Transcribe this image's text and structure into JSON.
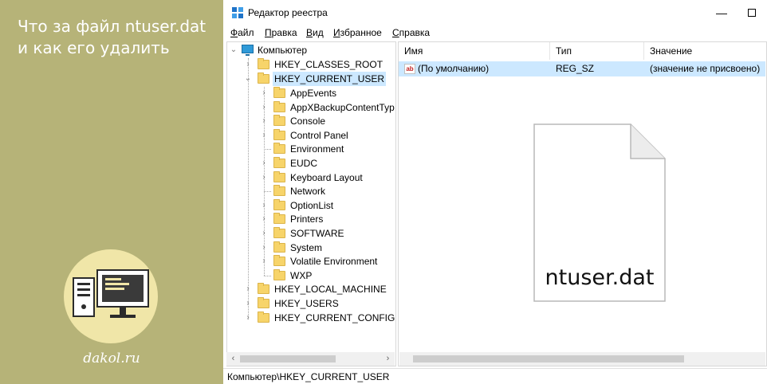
{
  "banner": {
    "title": "Что за файл ntuser.dat и как его удалить",
    "site": "dakol.ru",
    "logo_icon": "computer-monitor-icon",
    "colors": {
      "background": "#b6b378",
      "circle": "#f0e6a8"
    }
  },
  "window": {
    "title": "Редактор реестра",
    "icons": {
      "app": "registry-editor-icon",
      "minimize": "minimize-icon",
      "maximize": "maximize-icon"
    },
    "menu": [
      {
        "label": "Файл",
        "key": "Ф",
        "rest": "айл"
      },
      {
        "label": "Правка",
        "key": "П",
        "rest": "равка"
      },
      {
        "label": "Вид",
        "key": "В",
        "rest": "ид"
      },
      {
        "label": "Избранное",
        "key": "И",
        "rest": "збранное"
      },
      {
        "label": "Справка",
        "key": "С",
        "rest": "правка"
      }
    ]
  },
  "tree": {
    "root": "Компьютер",
    "hives_top": [
      "HKEY_CLASSES_ROOT"
    ],
    "current": "HKEY_CURRENT_USER",
    "children": [
      {
        "label": "AppEvents",
        "expandable": true
      },
      {
        "label": "AppXBackupContentTyp",
        "expandable": true
      },
      {
        "label": "Console",
        "expandable": true
      },
      {
        "label": "Control Panel",
        "expandable": true
      },
      {
        "label": "Environment",
        "expandable": false
      },
      {
        "label": "EUDC",
        "expandable": true
      },
      {
        "label": "Keyboard Layout",
        "expandable": true
      },
      {
        "label": "Network",
        "expandable": false
      },
      {
        "label": "OptionList",
        "expandable": true
      },
      {
        "label": "Printers",
        "expandable": true
      },
      {
        "label": "SOFTWARE",
        "expandable": true
      },
      {
        "label": "System",
        "expandable": true
      },
      {
        "label": "Volatile Environment",
        "expandable": true
      },
      {
        "label": "WXP",
        "expandable": false
      }
    ],
    "hives_bottom": [
      "HKEY_LOCAL_MACHINE",
      "HKEY_USERS",
      "HKEY_CURRENT_CONFIG"
    ]
  },
  "list": {
    "columns": [
      "Имя",
      "Тип",
      "Значение"
    ],
    "rows": [
      {
        "name": "(По умолчанию)",
        "type": "REG_SZ",
        "value": "(значение не присвоено)",
        "icon": "string-value-icon",
        "icon_text": "ab"
      }
    ]
  },
  "overlay": {
    "file_label": "ntuser.dat",
    "icon": "file-document-icon"
  },
  "status": {
    "path": "Компьютер\\HKEY_CURRENT_USER"
  },
  "scroll": {
    "left": "‹",
    "right": "›"
  }
}
